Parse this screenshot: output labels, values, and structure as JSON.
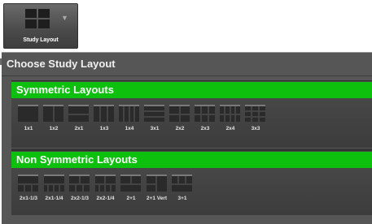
{
  "toolbar": {
    "button_label": "Study Layout"
  },
  "panel": {
    "title": "Choose Study Layout",
    "symmetric": {
      "header": "Symmetric Layouts",
      "items": [
        {
          "label": "1x1",
          "icon": "layout-1x1-icon"
        },
        {
          "label": "1x2",
          "icon": "layout-1x2-icon"
        },
        {
          "label": "2x1",
          "icon": "layout-2x1-icon"
        },
        {
          "label": "1x3",
          "icon": "layout-1x3-icon"
        },
        {
          "label": "1x4",
          "icon": "layout-1x4-icon"
        },
        {
          "label": "3x1",
          "icon": "layout-3x1-icon"
        },
        {
          "label": "2x2",
          "icon": "layout-2x2-icon"
        },
        {
          "label": "2x3",
          "icon": "layout-2x3-icon"
        },
        {
          "label": "2x4",
          "icon": "layout-2x4-icon"
        },
        {
          "label": "3x3",
          "icon": "layout-3x3-icon"
        }
      ]
    },
    "non_symmetric": {
      "header": "Non Symmetric Layouts",
      "items": [
        {
          "label": "2x1-1/3",
          "icon": "layout-2x1-1-3-icon"
        },
        {
          "label": "2x1-1/4",
          "icon": "layout-2x1-1-4-icon"
        },
        {
          "label": "2x2-1/3",
          "icon": "layout-2x2-1-3-icon"
        },
        {
          "label": "2x2-1/4",
          "icon": "layout-2x2-1-4-icon"
        },
        {
          "label": "2+1",
          "icon": "layout-2plus1-icon"
        },
        {
          "label": "2+1 Vert",
          "icon": "layout-2plus1-vert-icon"
        },
        {
          "label": "3+1",
          "icon": "layout-3plus1-icon"
        }
      ]
    }
  },
  "colors": {
    "section_header": "#0ec00e",
    "panel_bg": "#565656"
  }
}
